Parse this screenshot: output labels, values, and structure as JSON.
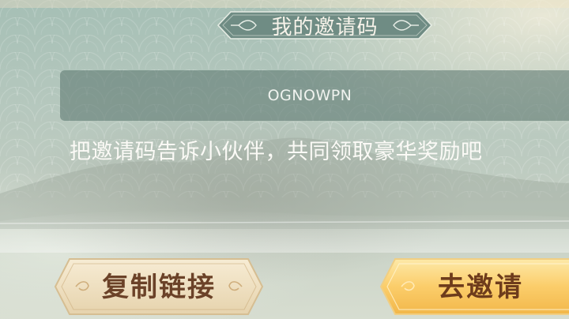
{
  "header": {
    "title": "我的邀请码"
  },
  "invite": {
    "code": "OGNOWPN",
    "hint": "把邀请码告诉小伙伴，共同领取豪华奖励吧"
  },
  "actions": {
    "copy_link_label": "复制链接",
    "invite_label": "去邀请"
  },
  "colors": {
    "panel_bg": "#b4c7bd",
    "banner": "#6f8c84",
    "code_box": "#58736b",
    "copy_button": "#f1e3c5",
    "invite_button": "#f9c45d",
    "button_text": "#6b4228"
  }
}
